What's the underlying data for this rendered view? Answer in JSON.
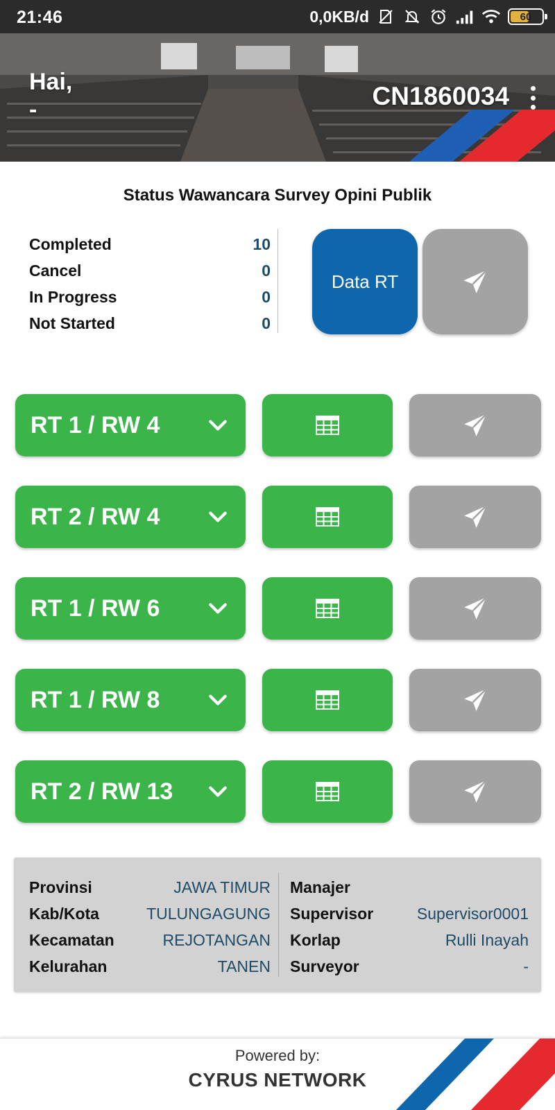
{
  "status_bar": {
    "time": "21:46",
    "network_speed": "0,0KB/d",
    "battery_level": "60",
    "battery_fraction": 0.6,
    "icons": [
      "no-sim-icon",
      "bell-off-icon",
      "alarm-icon",
      "signal-icon",
      "wifi-icon",
      "battery-icon"
    ]
  },
  "header": {
    "greeting": "Hai,",
    "user_name": "-",
    "user_id": "CN1860034"
  },
  "status": {
    "title": "Status Wawancara Survey Opini Publik",
    "items": [
      {
        "label": "Completed",
        "value": "10"
      },
      {
        "label": "Cancel",
        "value": "0"
      },
      {
        "label": "In Progress",
        "value": "0"
      },
      {
        "label": "Not Started",
        "value": "0"
      }
    ],
    "data_rt_label": "Data RT"
  },
  "rt_list": [
    {
      "label": "RT 1 / RW 4"
    },
    {
      "label": "RT 2 / RW 4"
    },
    {
      "label": "RT 1 / RW 6"
    },
    {
      "label": "RT 1 / RW 8"
    },
    {
      "label": "RT 2 / RW 13"
    }
  ],
  "info": {
    "left": [
      {
        "key": "Provinsi",
        "value": "JAWA TIMUR"
      },
      {
        "key": "Kab/Kota",
        "value": "TULUNGAGUNG"
      },
      {
        "key": "Kecamatan",
        "value": "REJOTANGAN"
      },
      {
        "key": "Kelurahan",
        "value": "TANEN"
      }
    ],
    "right": [
      {
        "key": "Manajer",
        "value": ""
      },
      {
        "key": "Supervisor",
        "value": "Supervisor0001"
      },
      {
        "key": "Korlap",
        "value": "Rulli Inayah"
      },
      {
        "key": "Surveyor",
        "value": "-"
      }
    ]
  },
  "footer": {
    "powered_by": "Powered by:",
    "brand": "CYRUS NETWORK"
  },
  "colors": {
    "primary_blue": "#0e67ad",
    "green": "#3bb54a",
    "gray_button": "#a3a3a3",
    "value_text": "#1f4a66",
    "brand_red": "#e52a2f"
  }
}
